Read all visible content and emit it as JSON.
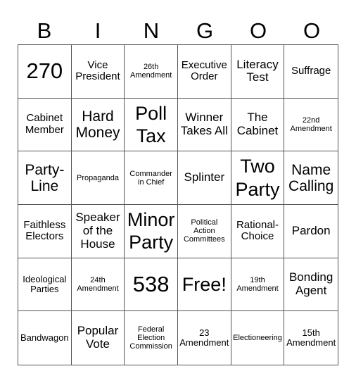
{
  "header": {
    "letters": [
      "B",
      "I",
      "N",
      "G",
      "O",
      "O"
    ]
  },
  "cells": [
    {
      "text": "270",
      "size": "num"
    },
    {
      "text": "Vice President",
      "size": "m"
    },
    {
      "text": "26th Amendment",
      "size": "xs"
    },
    {
      "text": "Executive Order",
      "size": "m"
    },
    {
      "text": "Literacy Test",
      "size": "l"
    },
    {
      "text": "Suffrage",
      "size": "m"
    },
    {
      "text": "Cabinet Member",
      "size": "m"
    },
    {
      "text": "Hard Money",
      "size": "xl"
    },
    {
      "text": "Poll Tax",
      "size": "xxl"
    },
    {
      "text": "Winner Takes All",
      "size": "l"
    },
    {
      "text": "The Cabinet",
      "size": "l"
    },
    {
      "text": "22nd Amendment",
      "size": "xs"
    },
    {
      "text": "Party-Line",
      "size": "xl"
    },
    {
      "text": "Propaganda",
      "size": "xs"
    },
    {
      "text": "Commander in Chief",
      "size": "xs"
    },
    {
      "text": "Splinter",
      "size": "l"
    },
    {
      "text": "Two Party",
      "size": "xxl"
    },
    {
      "text": "Name Calling",
      "size": "xl"
    },
    {
      "text": "Faithless Electors",
      "size": "m"
    },
    {
      "text": "Speaker of the House",
      "size": "l"
    },
    {
      "text": "Minor Party",
      "size": "xxl"
    },
    {
      "text": "Political Action Committees",
      "size": "xs"
    },
    {
      "text": "Rational-Choice",
      "size": "m"
    },
    {
      "text": "Pardon",
      "size": "l"
    },
    {
      "text": "Ideological Parties",
      "size": "s"
    },
    {
      "text": "24th Amendment",
      "size": "xs"
    },
    {
      "text": "538",
      "size": "num"
    },
    {
      "text": "Free!",
      "size": "xxl"
    },
    {
      "text": "19th Amendment",
      "size": "xs"
    },
    {
      "text": "Bonding Agent",
      "size": "l"
    },
    {
      "text": "Bandwagon",
      "size": "s"
    },
    {
      "text": "Popular Vote",
      "size": "l"
    },
    {
      "text": "Federal Election Commission",
      "size": "xs"
    },
    {
      "text": "23 Amendment",
      "size": "s"
    },
    {
      "text": "Electioneering",
      "size": "xs"
    },
    {
      "text": "15th Amendment",
      "size": "s"
    }
  ]
}
